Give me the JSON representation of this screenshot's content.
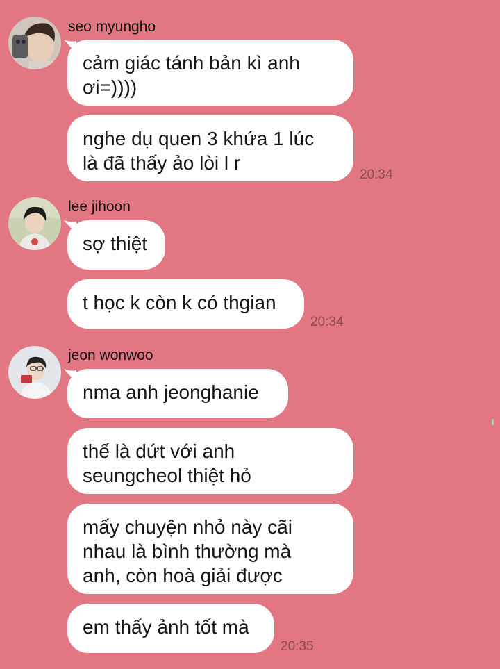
{
  "colors": {
    "background": "#e27682",
    "bubble": "#ffffff",
    "time": "#8a4a52"
  },
  "groups": [
    {
      "sender": "seo myungho",
      "avatar": "avatar-seo-myungho",
      "messages": [
        "cảm giác tánh bản kì anh\nơi=))))",
        "nghe dụ quen 3 khứa 1 lúc\nlà đã thấy ảo lòi l r"
      ],
      "time": "20:34"
    },
    {
      "sender": "lee jihoon",
      "avatar": "avatar-lee-jihoon",
      "messages": [
        "sợ thiệt",
        "t học k còn k có thgian"
      ],
      "time": "20:34"
    },
    {
      "sender": "jeon wonwoo",
      "avatar": "avatar-jeon-wonwoo",
      "messages": [
        "nma anh jeonghanie",
        "thế là dứt với anh\nseungcheol thiệt hỏ",
        "mấy chuyện nhỏ này cãi\nnhau là bình thường mà\nanh, còn hoà giải được",
        "em thấy ảnh tốt mà"
      ],
      "time": "20:35"
    }
  ]
}
